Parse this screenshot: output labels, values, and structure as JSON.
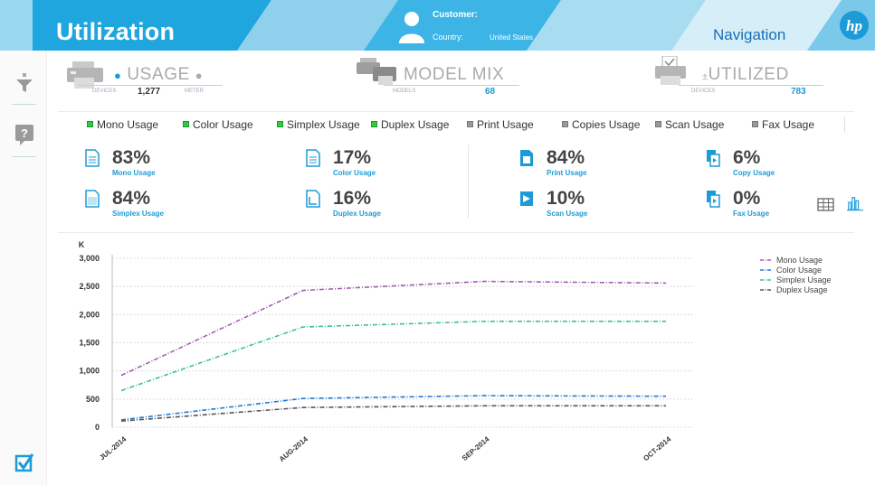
{
  "header": {
    "title": "Utilization",
    "customer_label": "Customer:",
    "country_label": "Country:",
    "country_value": "United States",
    "navigation": "Navigation",
    "logo_text": "hp"
  },
  "colors": {
    "header_blue": "#20a8e0",
    "header_light": "#bfe4f2",
    "accent": "#1d9bd7",
    "mono": "#a05bb0",
    "color": "#1f78d6",
    "simplex": "#3cbfa0",
    "duplex": "#555555",
    "filter_green": "#2ecc40",
    "filter_gray": "#999999"
  },
  "rail": {
    "filter_icon": "funnel-icon",
    "help_icon": "help-icon",
    "check_icon": "checkbox-icon"
  },
  "summary": {
    "usage": {
      "title": "USAGE",
      "devices_label": "DEVICES",
      "devices_value": "1,277",
      "meter_label": "METER"
    },
    "model_mix": {
      "title": "MODEL MIX",
      "models_label": "MODELS",
      "models_value": "68"
    },
    "utilized": {
      "title": "UTILIZED",
      "devices_label": "DEVICES",
      "devices_value": "783"
    }
  },
  "filters": [
    {
      "label": "Mono Usage",
      "active": true
    },
    {
      "label": "Color Usage",
      "active": true
    },
    {
      "label": "Simplex Usage",
      "active": true
    },
    {
      "label": "Duplex Usage",
      "active": true
    },
    {
      "label": "Print Usage",
      "active": false
    },
    {
      "label": "Copies Usage",
      "active": false
    },
    {
      "label": "Scan Usage",
      "active": false
    },
    {
      "label": "Fax Usage",
      "active": false
    }
  ],
  "kpis": [
    {
      "value": "83%",
      "label": "Mono Usage",
      "icon": "document-icon"
    },
    {
      "value": "84%",
      "label": "Simplex Usage",
      "icon": "document-icon"
    },
    {
      "value": "17%",
      "label": "Color Usage",
      "icon": "color-document-icon"
    },
    {
      "value": "16%",
      "label": "Duplex Usage",
      "icon": "duplex-document-icon"
    },
    {
      "value": "84%",
      "label": "Print Usage",
      "icon": "print-icon"
    },
    {
      "value": "10%",
      "label": "Scan Usage",
      "icon": "scan-icon"
    },
    {
      "value": "6%",
      "label": "Copy Usage",
      "icon": "copy-icon"
    },
    {
      "value": "0%",
      "label": "Fax Usage",
      "icon": "fax-icon"
    }
  ],
  "chart_data": {
    "type": "line",
    "ylabel": "K",
    "categories": [
      "JUL-2014",
      "AUG-2014",
      "SEP-2014",
      "OCT-2014"
    ],
    "ylim": [
      0,
      3000
    ],
    "yticks": [
      "0",
      "500",
      "1,000",
      "1,500",
      "2,000",
      "2,500",
      "3,000"
    ],
    "ytick_values": [
      0,
      500,
      1000,
      1500,
      2000,
      2500,
      3000
    ],
    "grid": true,
    "legend_position": "top-right",
    "series": [
      {
        "name": "Mono Usage",
        "values": [
          920,
          2430,
          2590,
          2560
        ],
        "color": "#a05bb0"
      },
      {
        "name": "Color Usage",
        "values": [
          130,
          510,
          560,
          550
        ],
        "color": "#1f78d6"
      },
      {
        "name": "Simplex Usage",
        "values": [
          650,
          1780,
          1880,
          1880
        ],
        "color": "#3cbfa0"
      },
      {
        "name": "Duplex Usage",
        "values": [
          110,
          350,
          380,
          380
        ],
        "color": "#555555"
      }
    ]
  }
}
